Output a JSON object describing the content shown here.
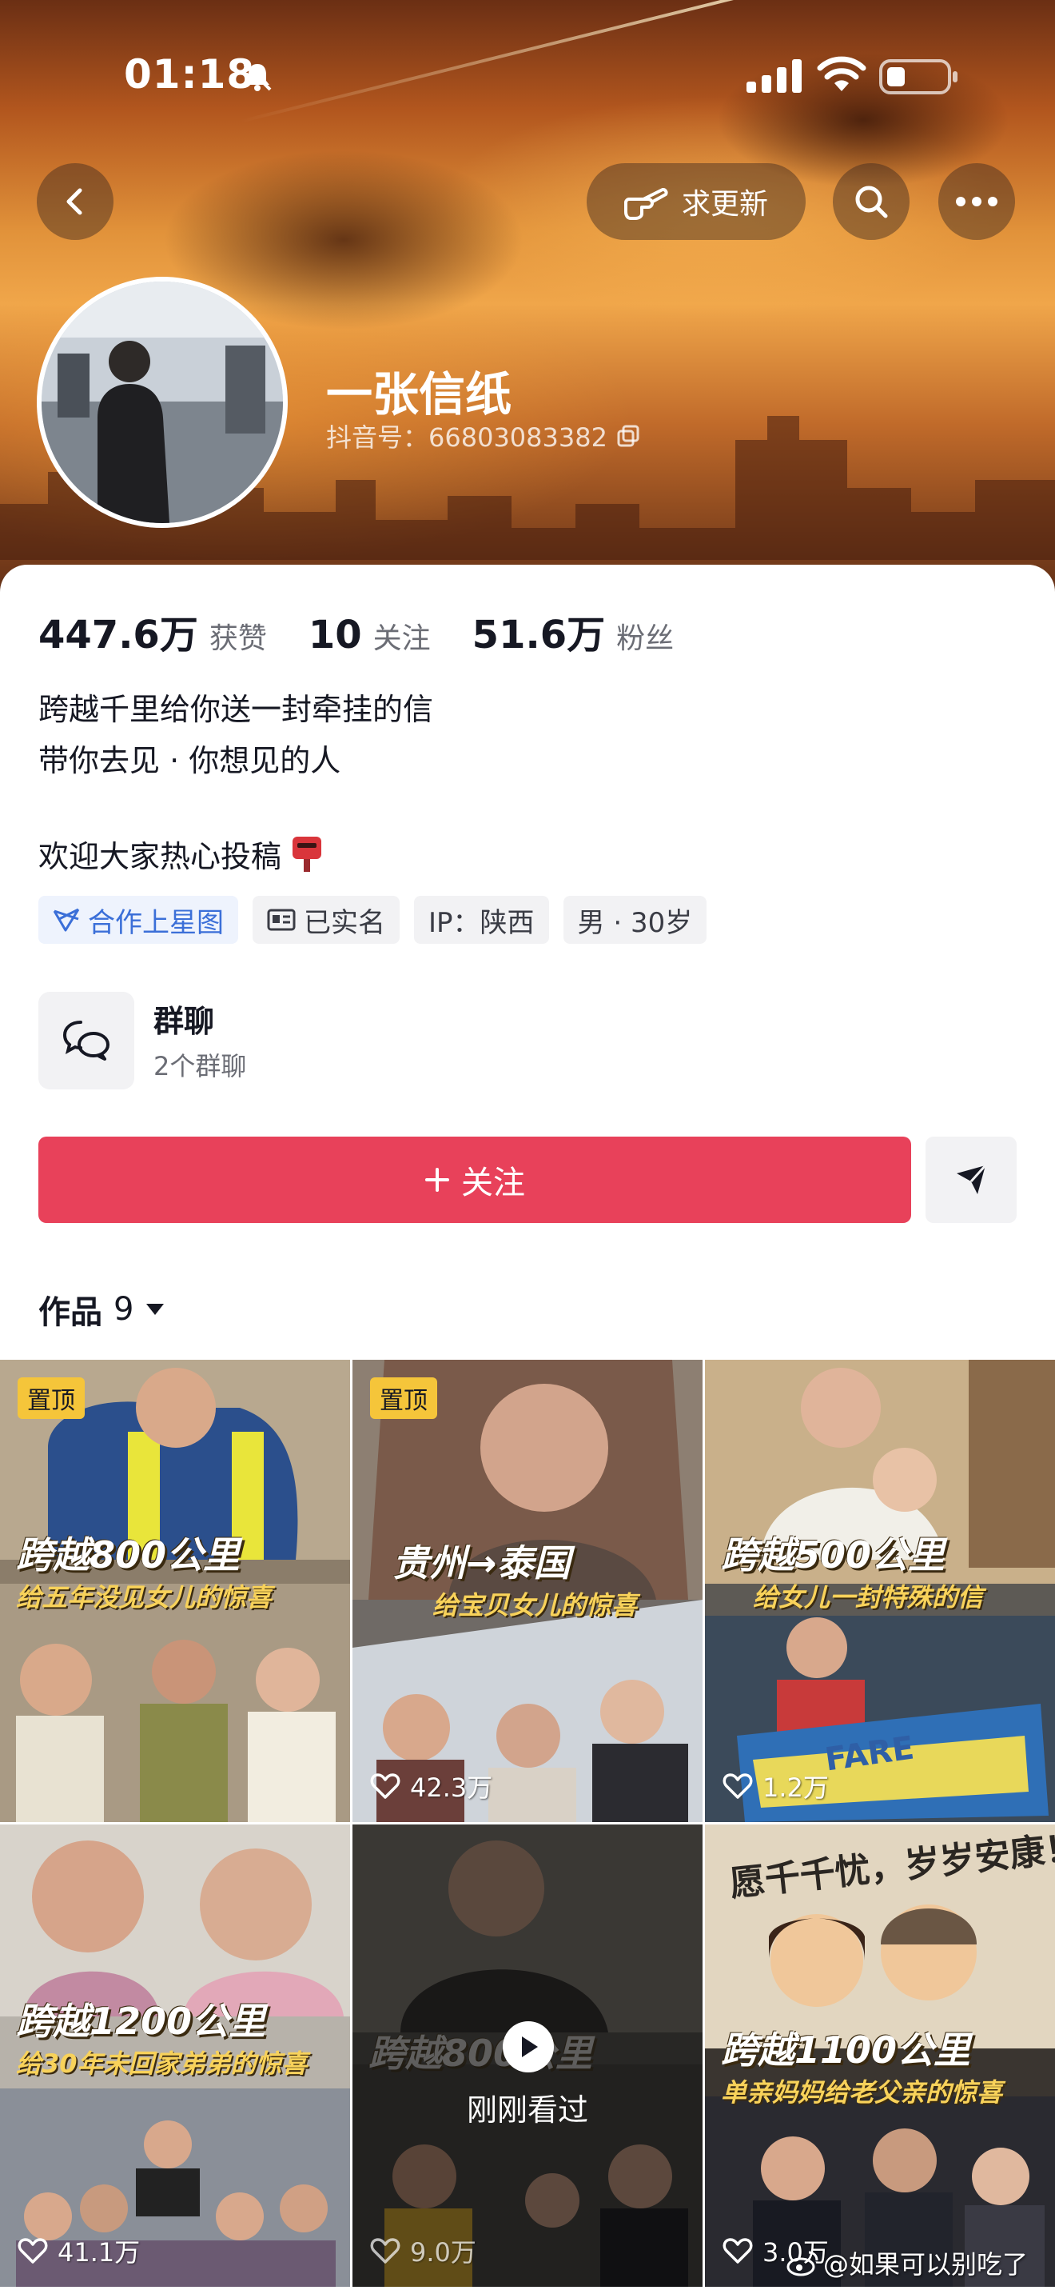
{
  "status_bar": {
    "time": "01:18"
  },
  "nav": {
    "update_label": "求更新"
  },
  "profile": {
    "name": "一张信纸",
    "douyin_id": "抖音号：66803083382"
  },
  "stats": [
    {
      "value": "447.6万",
      "label": "获赞"
    },
    {
      "value": "10",
      "label": "关注"
    },
    {
      "value": "51.6万",
      "label": "粉丝"
    }
  ],
  "bio": {
    "line1": "跨越千里给你送一封牵挂的信",
    "line2": "带你去见 · 你想见的人",
    "line3": "欢迎大家热心投稿"
  },
  "tags": {
    "star": "合作上星图",
    "verified": "已实名",
    "ip": "IP：陕西",
    "gender_age": "男 · 30岁"
  },
  "group_chat": {
    "title": "群聊",
    "subtitle": "2个群聊"
  },
  "follow_label": "关注",
  "works": {
    "label": "作品",
    "count": "9"
  },
  "pin_label": "置顶",
  "videos": [
    {
      "title": "跨越800公里",
      "subtitle": "给五年没见女儿的惊喜",
      "pinned": true,
      "likes": ""
    },
    {
      "title": "贵州→泰国",
      "subtitle": "给宝贝女儿的惊喜",
      "pinned": true,
      "likes": "42.3万"
    },
    {
      "title": "跨越500公里",
      "subtitle": "给女儿一封特殊的信",
      "pinned": false,
      "likes": "1.2万"
    },
    {
      "title": "跨越1200公里",
      "subtitle": "给30年未回家弟弟的惊喜",
      "pinned": false,
      "likes": "41.1万"
    },
    {
      "title": "跨越800公里",
      "subtitle": "",
      "pinned": false,
      "likes": "9.0万",
      "watched_label": "刚刚看过"
    },
    {
      "title": "跨越1100公里",
      "subtitle": "单亲妈妈给老父亲的惊喜",
      "pinned": false,
      "likes": "3.0万"
    }
  ],
  "tile_text": {
    "bg_title": "愿千千忧，岁岁安康！",
    "banner": "FARE"
  },
  "watermark": "@如果可以别吃了",
  "colors": {
    "follow": "#e8415a",
    "pin": "#f5c53a",
    "star_tag": "#3b6fd8"
  }
}
